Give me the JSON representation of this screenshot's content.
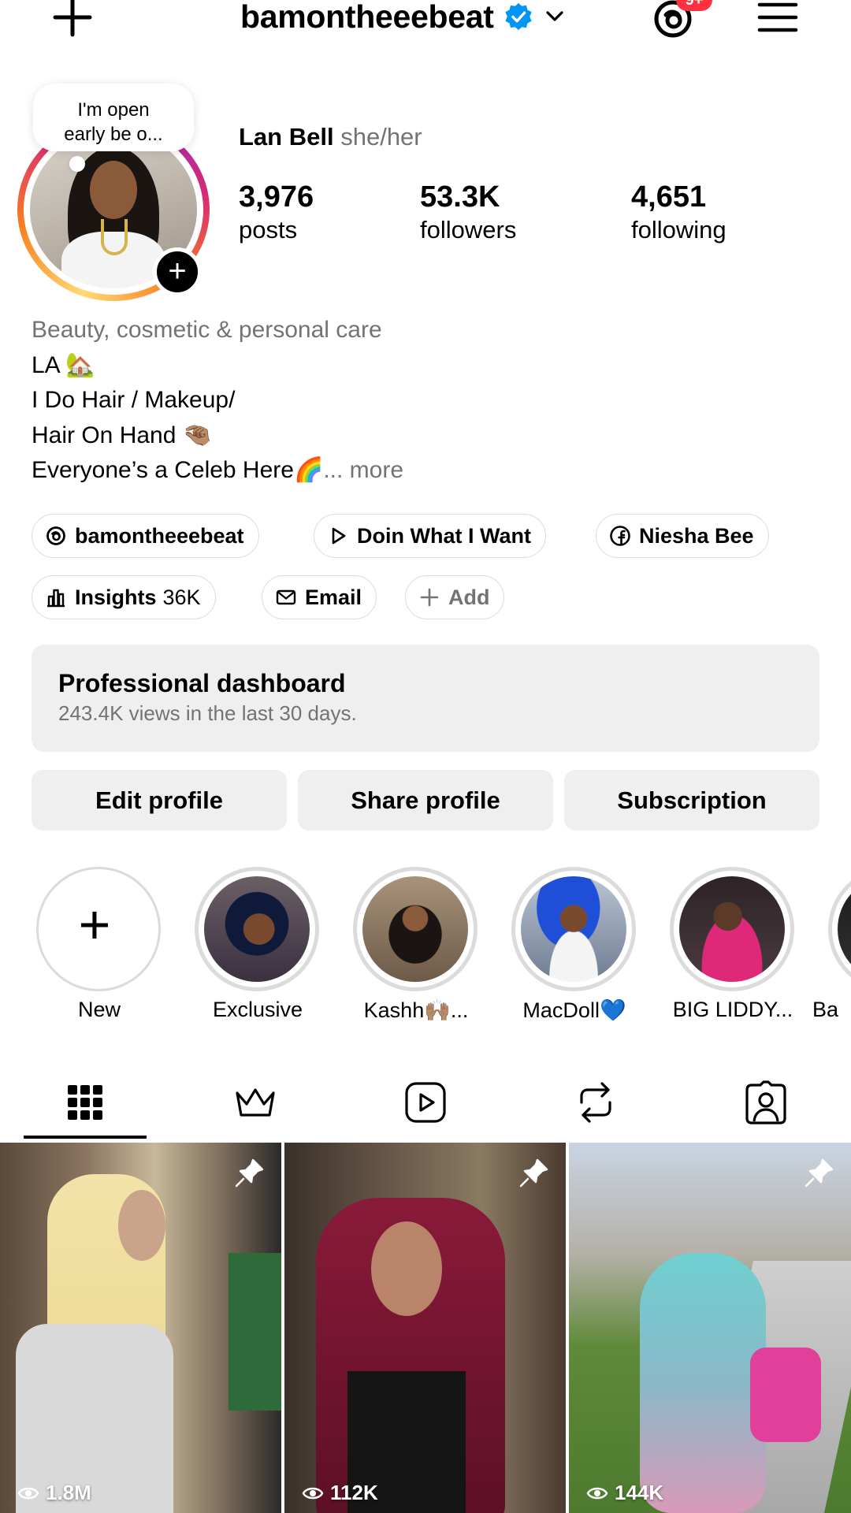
{
  "header": {
    "username": "bamontheeebeat",
    "notification_count": "9+",
    "icons": [
      "plus-icon",
      "verified-badge-icon",
      "chevron-down-icon",
      "threads-icon",
      "menu-icon"
    ]
  },
  "profile": {
    "note": [
      "I'm open",
      "early be o..."
    ],
    "name": "Lan Bell",
    "pronouns": "she/her",
    "stats": [
      {
        "value": "3,976",
        "label": "posts"
      },
      {
        "value": "53.3K",
        "label": "followers"
      },
      {
        "value": "4,651",
        "label": "following"
      }
    ]
  },
  "bio": {
    "category": "Beauty, cosmetic & personal care",
    "lines": [
      "LA 🏡",
      "I Do Hair / Makeup/",
      "Hair On Hand 🤏🏽",
      "Everyone’s a Celeb Here🌈"
    ],
    "ellipsis": "...",
    "more": "more"
  },
  "links": {
    "threads": "bamontheeebeat",
    "music": "Doin What I Want",
    "facebook": "Niesha Bee",
    "insights_label": "Insights",
    "insights_value": "36K",
    "email": "Email",
    "add": "Add"
  },
  "dashboard": {
    "title": "Professional dashboard",
    "subtitle": "243.4K views in the last 30 days."
  },
  "buttons": {
    "edit": "Edit profile",
    "share": "Share profile",
    "subscription": "Subscription"
  },
  "highlights": [
    {
      "label": "New"
    },
    {
      "label": "Exclusive"
    },
    {
      "label": "Kashh🙌🏽..."
    },
    {
      "label": "MacDoll💙"
    },
    {
      "label": "BIG LIDDY..."
    },
    {
      "label": "Ba"
    }
  ],
  "tabs": [
    "grid-icon",
    "crown-icon",
    "reels-icon",
    "reposts-icon",
    "tagged-icon"
  ],
  "posts": [
    {
      "views": "1.8M",
      "pinned": true
    },
    {
      "views": "112K",
      "pinned": true
    },
    {
      "views": "144K",
      "pinned": true
    }
  ],
  "colors": {
    "verified": "#0095f6",
    "badge": "#ff3040",
    "secondary_text": "#737373",
    "button_bg": "#efefef"
  }
}
